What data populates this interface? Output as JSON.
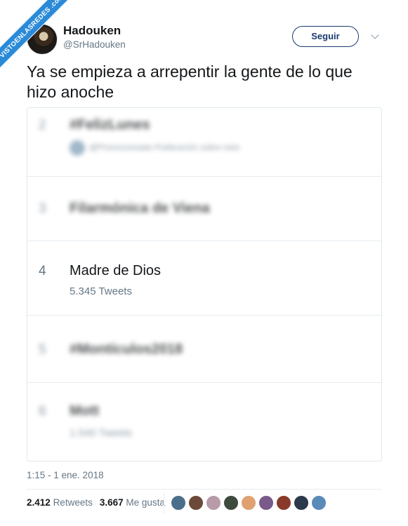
{
  "watermark": {
    "text": "VISTOENLASREDES .com"
  },
  "author": {
    "display_name": "Hadouken",
    "handle": "@SrHadouken",
    "avatar": "profile-photo"
  },
  "follow_button": {
    "label": "Seguir"
  },
  "menu_icon": "chevron-down-icon",
  "tweet": {
    "text": "Ya se empieza a arrepentir la gente de lo que hizo anoche",
    "timestamp": "1:15 - 1 ene. 2018"
  },
  "trends": [
    {
      "rank": "2",
      "name": "#FelizLunes",
      "detail": "@Promocionado·Publicación sobre esto",
      "blurred": true
    },
    {
      "rank": "3",
      "name": "Filarmónica de Viena",
      "detail": "",
      "blurred": true
    },
    {
      "rank": "4",
      "name": "Madre de Dios",
      "detail": "5.345 Tweets",
      "blurred": false
    },
    {
      "rank": "5",
      "name": "#Montículos2018",
      "detail": "",
      "blurred": true
    },
    {
      "rank": "6",
      "name": "Mott",
      "detail": "1.540 Tweets",
      "blurred": true
    }
  ],
  "stats": {
    "retweets_count": "2.412",
    "retweets_label": "Retweets",
    "likes_count": "3.667",
    "likes_label": "Me gusta"
  },
  "likers": [
    {
      "name": "liker-avatar-1",
      "color": "#4a6f8a"
    },
    {
      "name": "liker-avatar-2",
      "color": "#6b4a3a"
    },
    {
      "name": "liker-avatar-3",
      "color": "#b89aa8"
    },
    {
      "name": "liker-avatar-4",
      "color": "#3e4a3e"
    },
    {
      "name": "liker-avatar-5",
      "color": "#e0a070"
    },
    {
      "name": "liker-avatar-6",
      "color": "#7a5a8a"
    },
    {
      "name": "liker-avatar-7",
      "color": "#8a3a2a"
    },
    {
      "name": "liker-avatar-8",
      "color": "#2a3a4a"
    },
    {
      "name": "liker-avatar-9",
      "color": "#5a8ab8"
    }
  ]
}
